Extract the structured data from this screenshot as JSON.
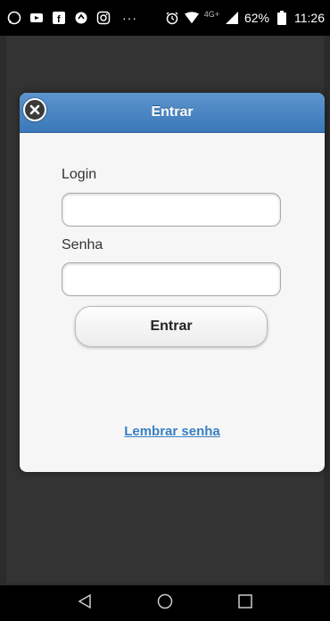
{
  "status_bar": {
    "battery_percent": "62%",
    "time": "11:26",
    "network": "4G+",
    "more": "···"
  },
  "dialog": {
    "title": "Entrar",
    "login_label": "Login",
    "login_value": "",
    "password_label": "Senha",
    "password_value": "",
    "submit_label": "Entrar",
    "forgot_link": "Lembrar senha"
  },
  "colors": {
    "header": "#3a78b8",
    "link": "#3a80c4"
  },
  "nav_icons": [
    "back-icon",
    "home-icon",
    "recents-icon"
  ]
}
